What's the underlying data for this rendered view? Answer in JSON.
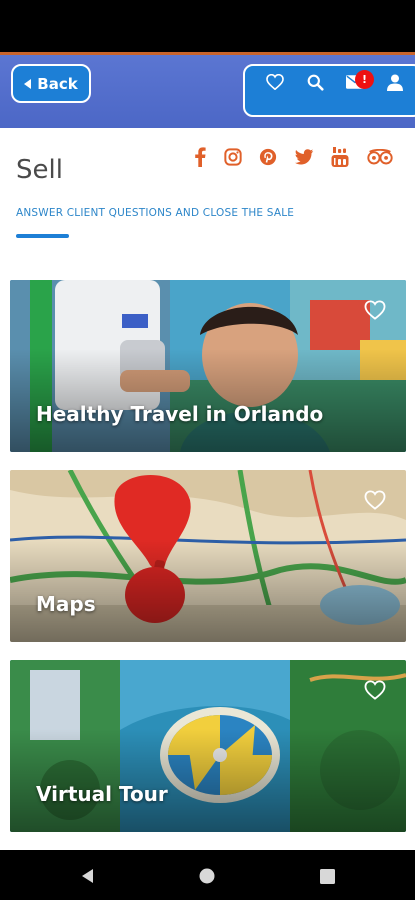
{
  "header": {
    "back_label": "Back",
    "notification_count": "!"
  },
  "page": {
    "title": "Sell",
    "subtitle": "ANSWER CLIENT QUESTIONS AND CLOSE THE SALE"
  },
  "social": [
    {
      "icon": "facebook-icon"
    },
    {
      "icon": "instagram-icon"
    },
    {
      "icon": "pinterest-icon"
    },
    {
      "icon": "twitter-icon"
    },
    {
      "icon": "youtube-icon"
    },
    {
      "icon": "tripadvisor-icon"
    }
  ],
  "cards": [
    {
      "label": "Healthy Travel in Orlando"
    },
    {
      "label": "Maps"
    },
    {
      "label": "Virtual Tour"
    }
  ],
  "colors": {
    "header_blue": "#4c67c6",
    "button_blue": "#1d7fd6",
    "accent_orange": "#e0602a",
    "badge_red": "#e11111"
  }
}
